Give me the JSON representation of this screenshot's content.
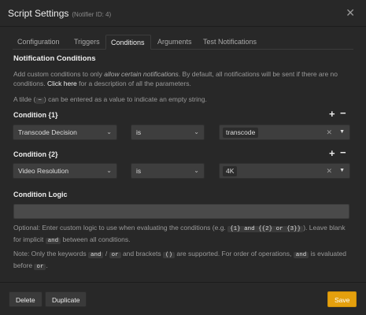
{
  "header": {
    "title": "Script Settings",
    "subtitle": "(Notifier ID: 4)"
  },
  "tabs": [
    {
      "label": "Configuration"
    },
    {
      "label": "Triggers"
    },
    {
      "label": "Conditions"
    },
    {
      "label": "Arguments"
    },
    {
      "label": "Test Notifications"
    }
  ],
  "active_tab": "Conditions",
  "section": {
    "title": "Notification Conditions",
    "desc_1": "Add custom conditions to only ",
    "desc_italic": "allow certain notifications",
    "desc_2": ". By default, all notifications will be sent if there are no conditions. ",
    "desc_link": "Click here",
    "desc_3": " for a description of all the parameters.",
    "tilde_1": "A tilde (",
    "tilde_code": "~",
    "tilde_2": ") can be entered as a value to indicate an empty string."
  },
  "conditions": [
    {
      "label": "Condition {1}",
      "parameter": "Transcode Decision",
      "operator": "is",
      "value": "transcode"
    },
    {
      "label": "Condition {2}",
      "parameter": "Video Resolution",
      "operator": "is",
      "value": "4K"
    }
  ],
  "logic": {
    "label": "Condition Logic",
    "value": "",
    "help_1": "Optional: Enter custom logic to use when evaluating the conditions (e.g. ",
    "help_code": "{1} and {{2} or {3}}",
    "help_2": "). Leave blank for implicit ",
    "help_code2": "and",
    "help_3": " between all conditions.",
    "note_1": "Note: Only the keywords ",
    "note_and": "and",
    "note_slash": " / ",
    "note_or": "or",
    "note_2": " and brackets ",
    "note_brackets": "()",
    "note_3": " are supported. For order of operations, ",
    "note_and2": "and",
    "note_4": " is evaluated before ",
    "note_or2": "or",
    "note_5": "."
  },
  "footer": {
    "delete": "Delete",
    "duplicate": "Duplicate",
    "save": "Save"
  },
  "icons": {
    "close": "close-icon",
    "add": "plus-icon",
    "remove": "minus-icon",
    "dropdown": "chevron-down-icon",
    "clear": "clear-icon"
  },
  "colors": {
    "accent": "#e5a00d",
    "background": "#282828"
  }
}
